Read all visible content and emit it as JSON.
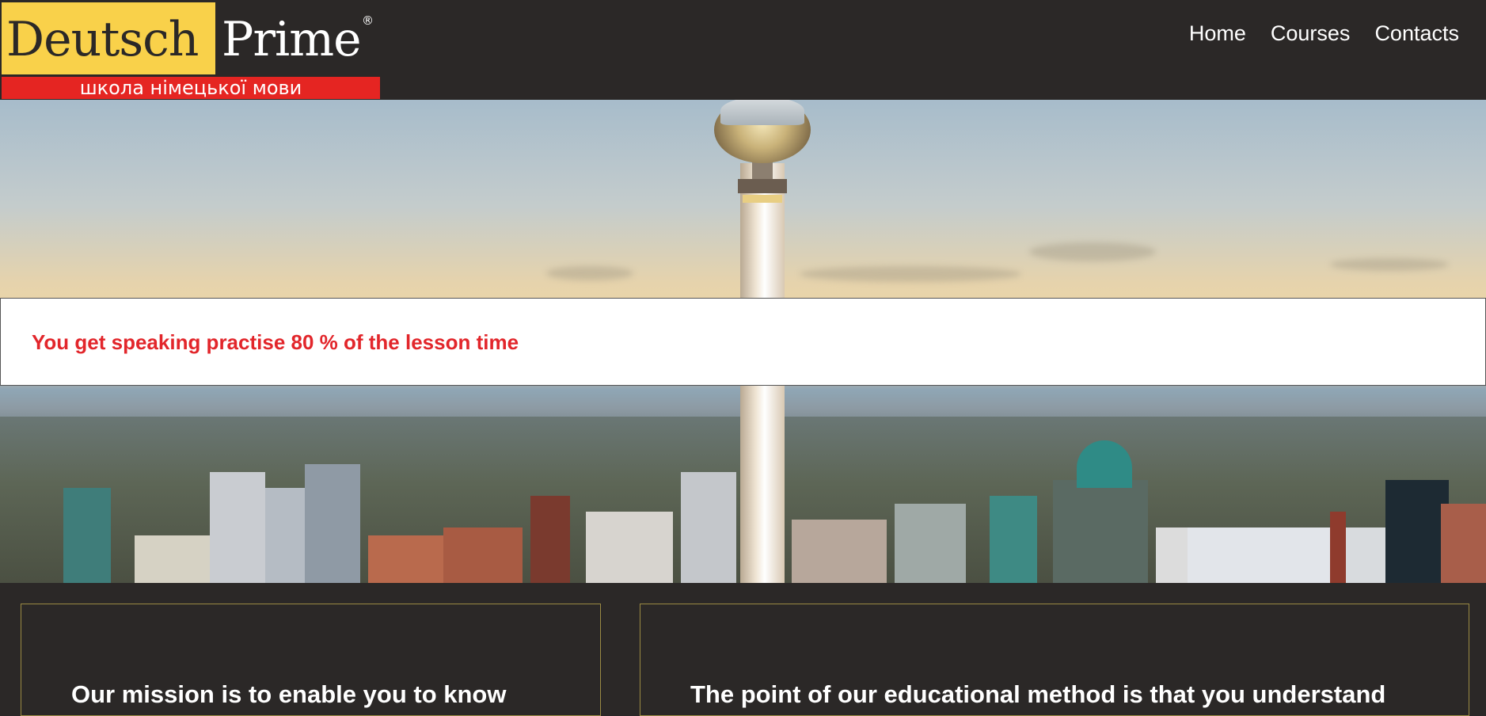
{
  "logo": {
    "word1": "Deutsch",
    "word2": "Prime",
    "registered": "®",
    "tagline": "школа німецької мови",
    "colors": {
      "yellow": "#f9d14a",
      "red": "#e52522",
      "dark": "#2b2827"
    }
  },
  "nav": {
    "items": [
      {
        "label": "Home"
      },
      {
        "label": "Courses"
      },
      {
        "label": "Contacts"
      }
    ]
  },
  "hero": {
    "image": "berlin-skyline-tv-tower",
    "banner_text": "You get speaking practise 80 % of the lesson time",
    "banner_color": "#e2262b"
  },
  "cards": [
    {
      "heading": "Our mission is to enable you to know"
    },
    {
      "heading": "The point of our educational method is that you understand"
    }
  ]
}
